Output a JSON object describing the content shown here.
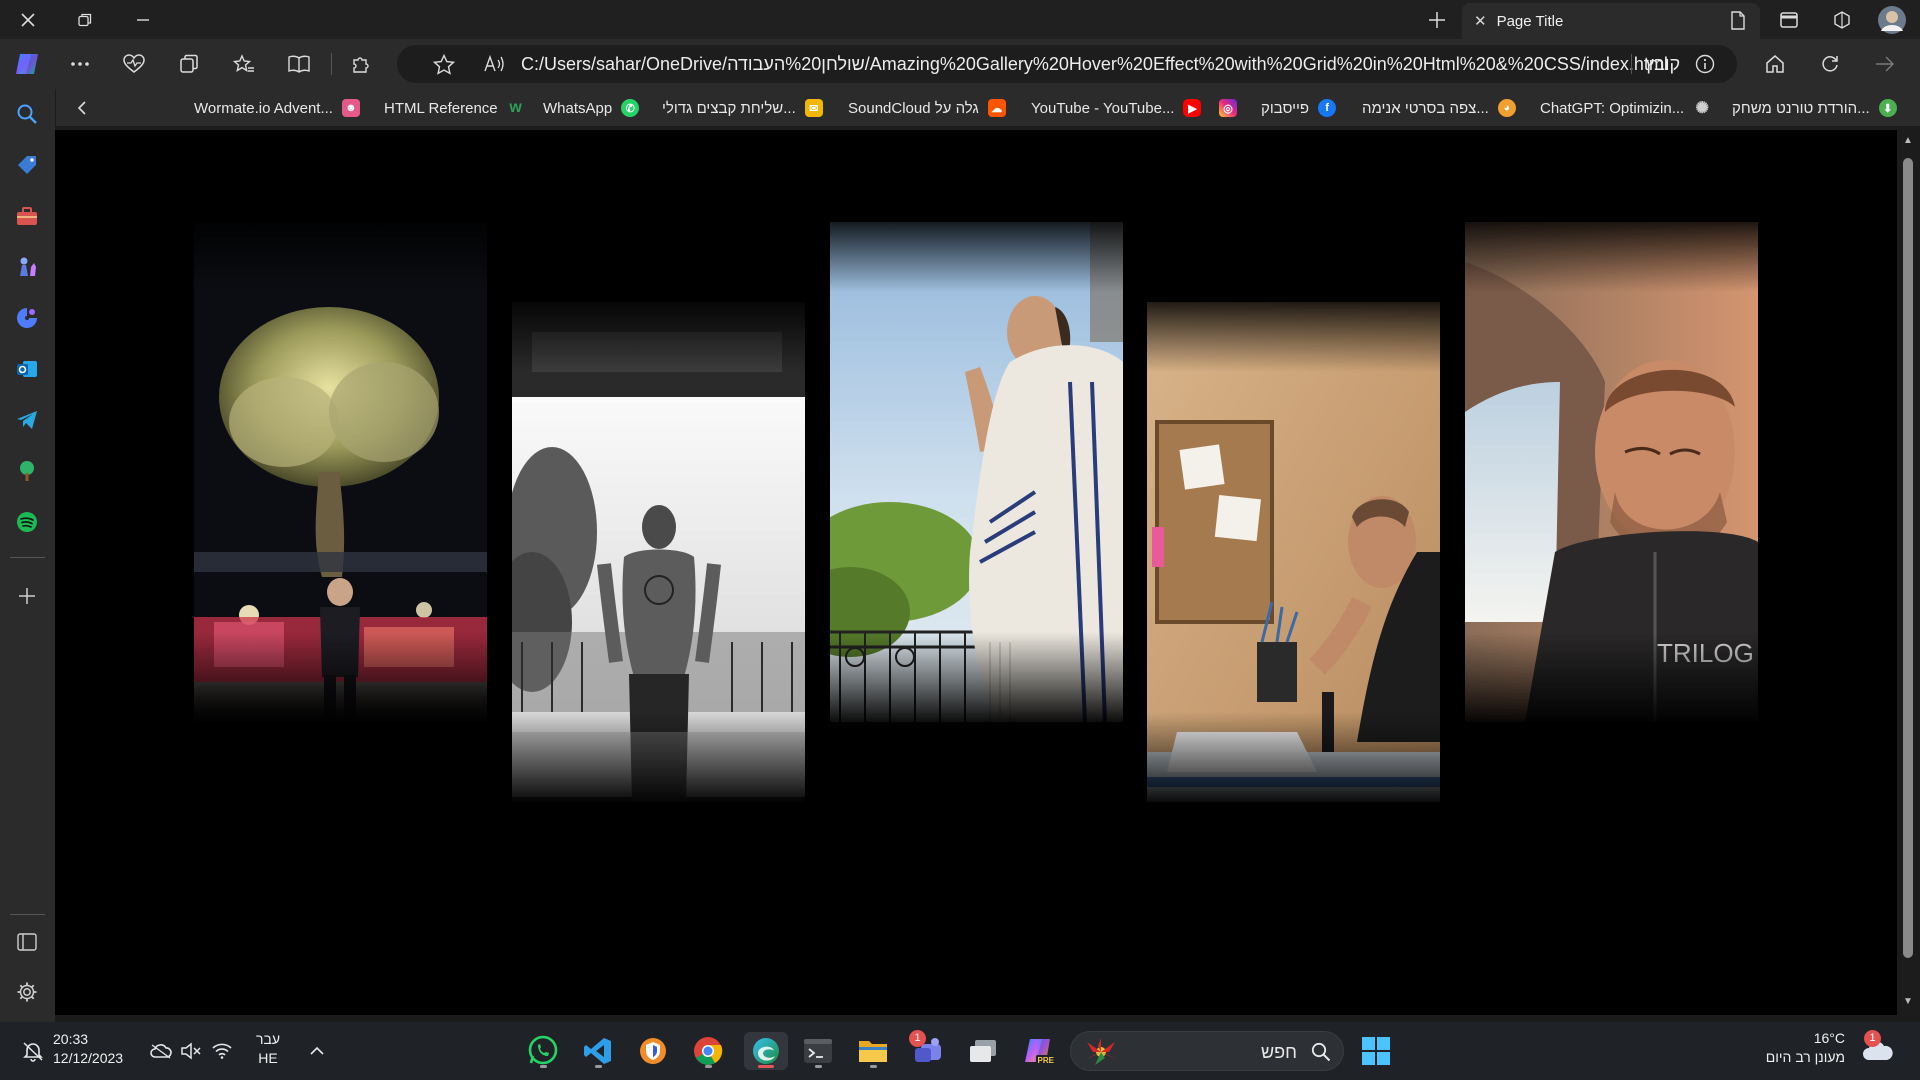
{
  "browser": {
    "tab_title": "Page Title",
    "address_url": "C:/Users/sahar/OneDrive/שולחן%20העבודה/Amazing%20Gallery%20Hover%20Effect%20with%20Grid%20in%20Html%20&%20CSS/index.html",
    "address_scheme_label": "קובץ"
  },
  "favorites": [
    {
      "label": "Wormate.io Advent...",
      "icon": "wormate-icon",
      "color": "#3b82c4"
    },
    {
      "label": "HTML Reference",
      "icon": "w3-icon",
      "color": "#2e9e5a"
    },
    {
      "label": "WhatsApp",
      "icon": "whatsapp-icon",
      "color": "#25d366"
    },
    {
      "label": "שליחת קבצים גדולי...",
      "icon": "wetransfer-icon",
      "color": "#f2b705"
    },
    {
      "label": "SoundCloud גלה על",
      "icon": "soundcloud-icon",
      "color": "#ff5500"
    },
    {
      "label": "YouTube - YouTube...",
      "icon": "youtube-icon",
      "color": "#ff0000"
    },
    {
      "label": "",
      "icon": "instagram-icon",
      "color": "#d6249f"
    },
    {
      "label": "פייסבוק",
      "icon": "facebook-icon",
      "color": "#1877f2"
    },
    {
      "label": "צפה בסרטי אנימה...",
      "icon": "anime-icon",
      "color": "#f0a030"
    },
    {
      "label": "ChatGPT: Optimizin...",
      "icon": "chatgpt-icon",
      "color": "#cfcfcf"
    },
    {
      "label": "הורדת טורנט משחק...",
      "icon": "torrent-icon",
      "color": "#4caf50"
    }
  ],
  "taskbar": {
    "time": "20:33",
    "date": "12/12/2023",
    "lang_top": "עבר",
    "lang_bottom": "HE",
    "search_placeholder": "חפש",
    "weather_temp": "16°C",
    "weather_desc": "מעונן רב היום",
    "chat_badge": "1",
    "weather_badge": "1"
  },
  "colors": {
    "titlebar": "#202020",
    "toolbar": "#2b2b2b",
    "page_background": "#000000",
    "taskbar": "#1f2226"
  },
  "gallery": [
    {
      "name": "photo-olive-tree-night"
    },
    {
      "name": "photo-balcony-bw"
    },
    {
      "name": "photo-prayer-tallit"
    },
    {
      "name": "photo-desk-thinking"
    },
    {
      "name": "photo-car-sunlight"
    }
  ]
}
